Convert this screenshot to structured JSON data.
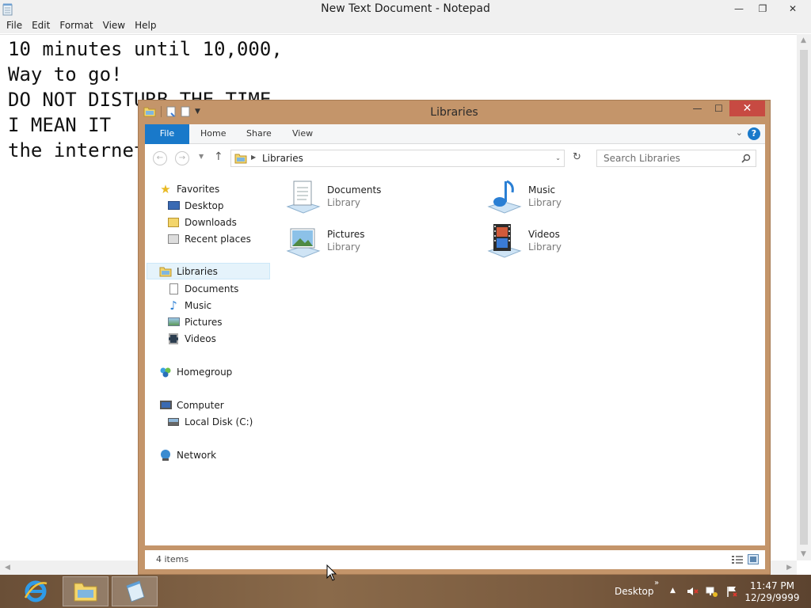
{
  "notepad": {
    "title": "New Text Document - Notepad",
    "menu": [
      "File",
      "Edit",
      "Format",
      "View",
      "Help"
    ],
    "lines": [
      "10 minutes until 10,000,",
      "Way to go!",
      "DO NOT DISTURB THE TIME",
      "I MEAN IT",
      "the internet"
    ]
  },
  "explorer": {
    "title": "Libraries",
    "ribbon_tabs": [
      "File",
      "Home",
      "Share",
      "View"
    ],
    "address": "Libraries",
    "search_placeholder": "Search Libraries",
    "nav": {
      "favorites": "Favorites",
      "desktop": "Desktop",
      "downloads": "Downloads",
      "recent": "Recent places",
      "libraries": "Libraries",
      "documents": "Documents",
      "music": "Music",
      "pictures": "Pictures",
      "videos": "Videos",
      "homegroup": "Homegroup",
      "computer": "Computer",
      "local_disk": "Local Disk (C:)",
      "network": "Network"
    },
    "tiles": [
      {
        "name": "Documents",
        "sub": "Library",
        "icon": "documents-library-icon"
      },
      {
        "name": "Music",
        "sub": "Library",
        "icon": "music-library-icon"
      },
      {
        "name": "Pictures",
        "sub": "Library",
        "icon": "pictures-library-icon"
      },
      {
        "name": "Videos",
        "sub": "Library",
        "icon": "videos-library-icon"
      }
    ],
    "status_count": "4 items"
  },
  "taskbar": {
    "desktop_label": "Desktop",
    "time": "11:47 PM",
    "date": "12/29/9999",
    "pinned": [
      "internet-explorer-icon",
      "file-explorer-icon",
      "notepad-icon"
    ]
  },
  "colors": {
    "explorer_frame": "#c4956a",
    "file_tab": "#1979ca",
    "close_button": "#c74a42"
  }
}
